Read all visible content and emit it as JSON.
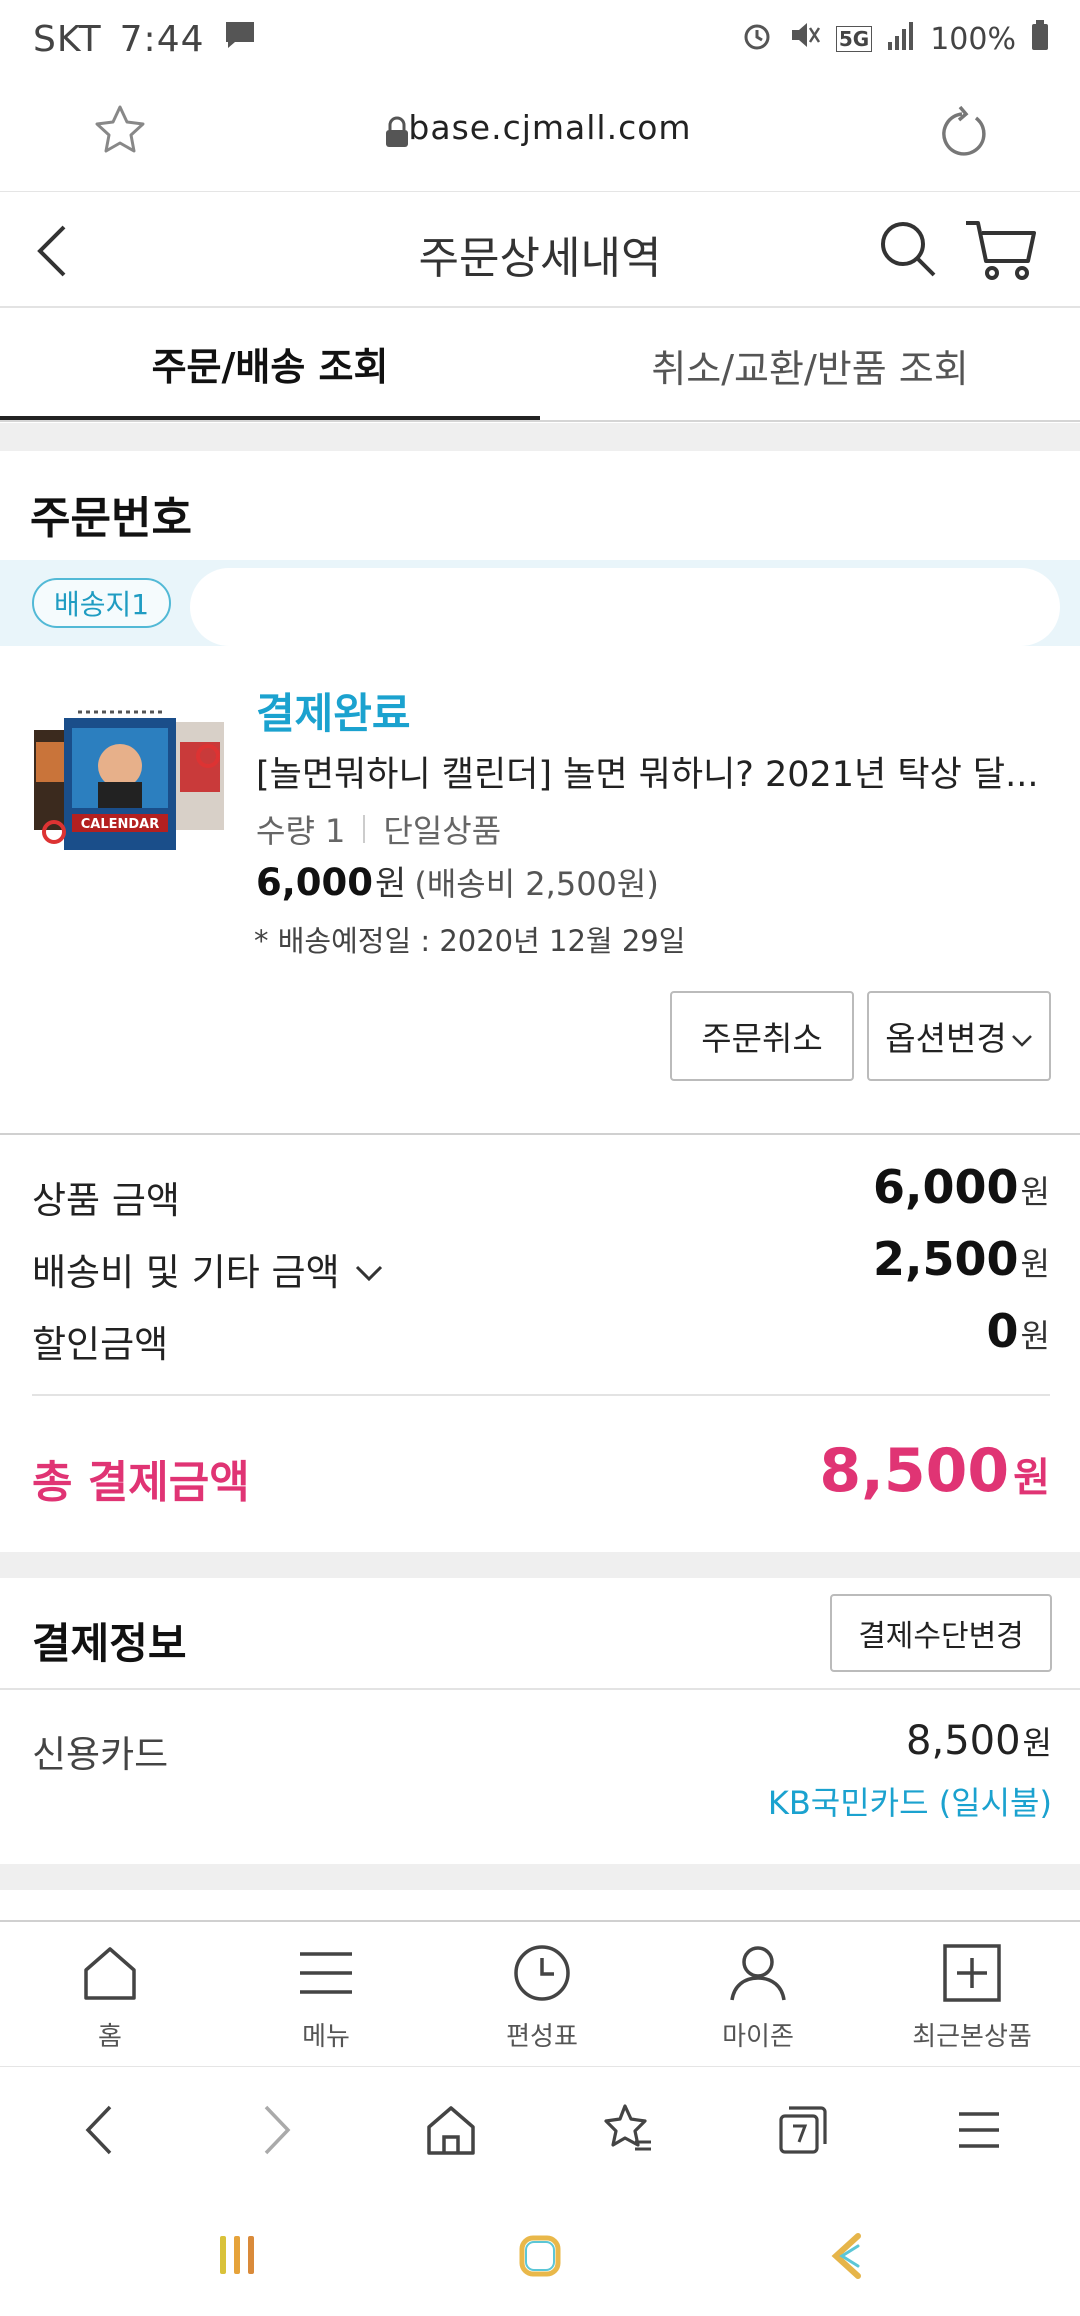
{
  "status_bar": {
    "carrier": "SKT",
    "time": "7:44",
    "network": "5G",
    "battery": "100%"
  },
  "browser": {
    "url": "base.cjmall.com"
  },
  "header": {
    "title": "주문상세내역"
  },
  "tabs": [
    {
      "label": "주문/배송 조회",
      "active": true
    },
    {
      "label": "취소/교환/반품 조회",
      "active": false
    }
  ],
  "order": {
    "order_number_label": "주문번호",
    "shipping_badge": "배송지1"
  },
  "product": {
    "status": "결제완료",
    "name": "[놀면뭐하니 캘린더] 놀면 뭐하니? 2021년 탁상 달...",
    "qty_label": "수량 1",
    "type": "단일상품",
    "price": "6,000",
    "price_unit": "원",
    "shipping_fee_note": "(배송비 2,500원)",
    "delivery_date": "* 배송예정일 : 2020년 12월 29일",
    "cancel_button": "주문취소",
    "option_button": "옵션변경"
  },
  "summary": {
    "rows": [
      {
        "label": "상품 금액",
        "value": "6,000",
        "unit": "원"
      },
      {
        "label": "배송비 및 기타 금액",
        "value": "2,500",
        "unit": "원"
      },
      {
        "label": "할인금액",
        "value": "0",
        "unit": "원"
      }
    ],
    "total_label": "총 결제금액",
    "total_value": "8,500",
    "total_unit": "원"
  },
  "payment": {
    "title": "결제정보",
    "change_button": "결제수단변경",
    "method": "신용카드",
    "amount": "8,500",
    "amount_unit": "원",
    "card_name": "KB국민카드 (일시불)"
  },
  "bottom_nav": [
    {
      "label": "홈",
      "icon": "home-icon"
    },
    {
      "label": "메뉴",
      "icon": "menu-icon"
    },
    {
      "label": "편성표",
      "icon": "clock-icon"
    },
    {
      "label": "마이존",
      "icon": "user-icon"
    },
    {
      "label": "최근본상품",
      "icon": "plus-box-icon"
    }
  ],
  "colors": {
    "accent_blue": "#1ba2cf",
    "accent_pink": "#e03474"
  }
}
